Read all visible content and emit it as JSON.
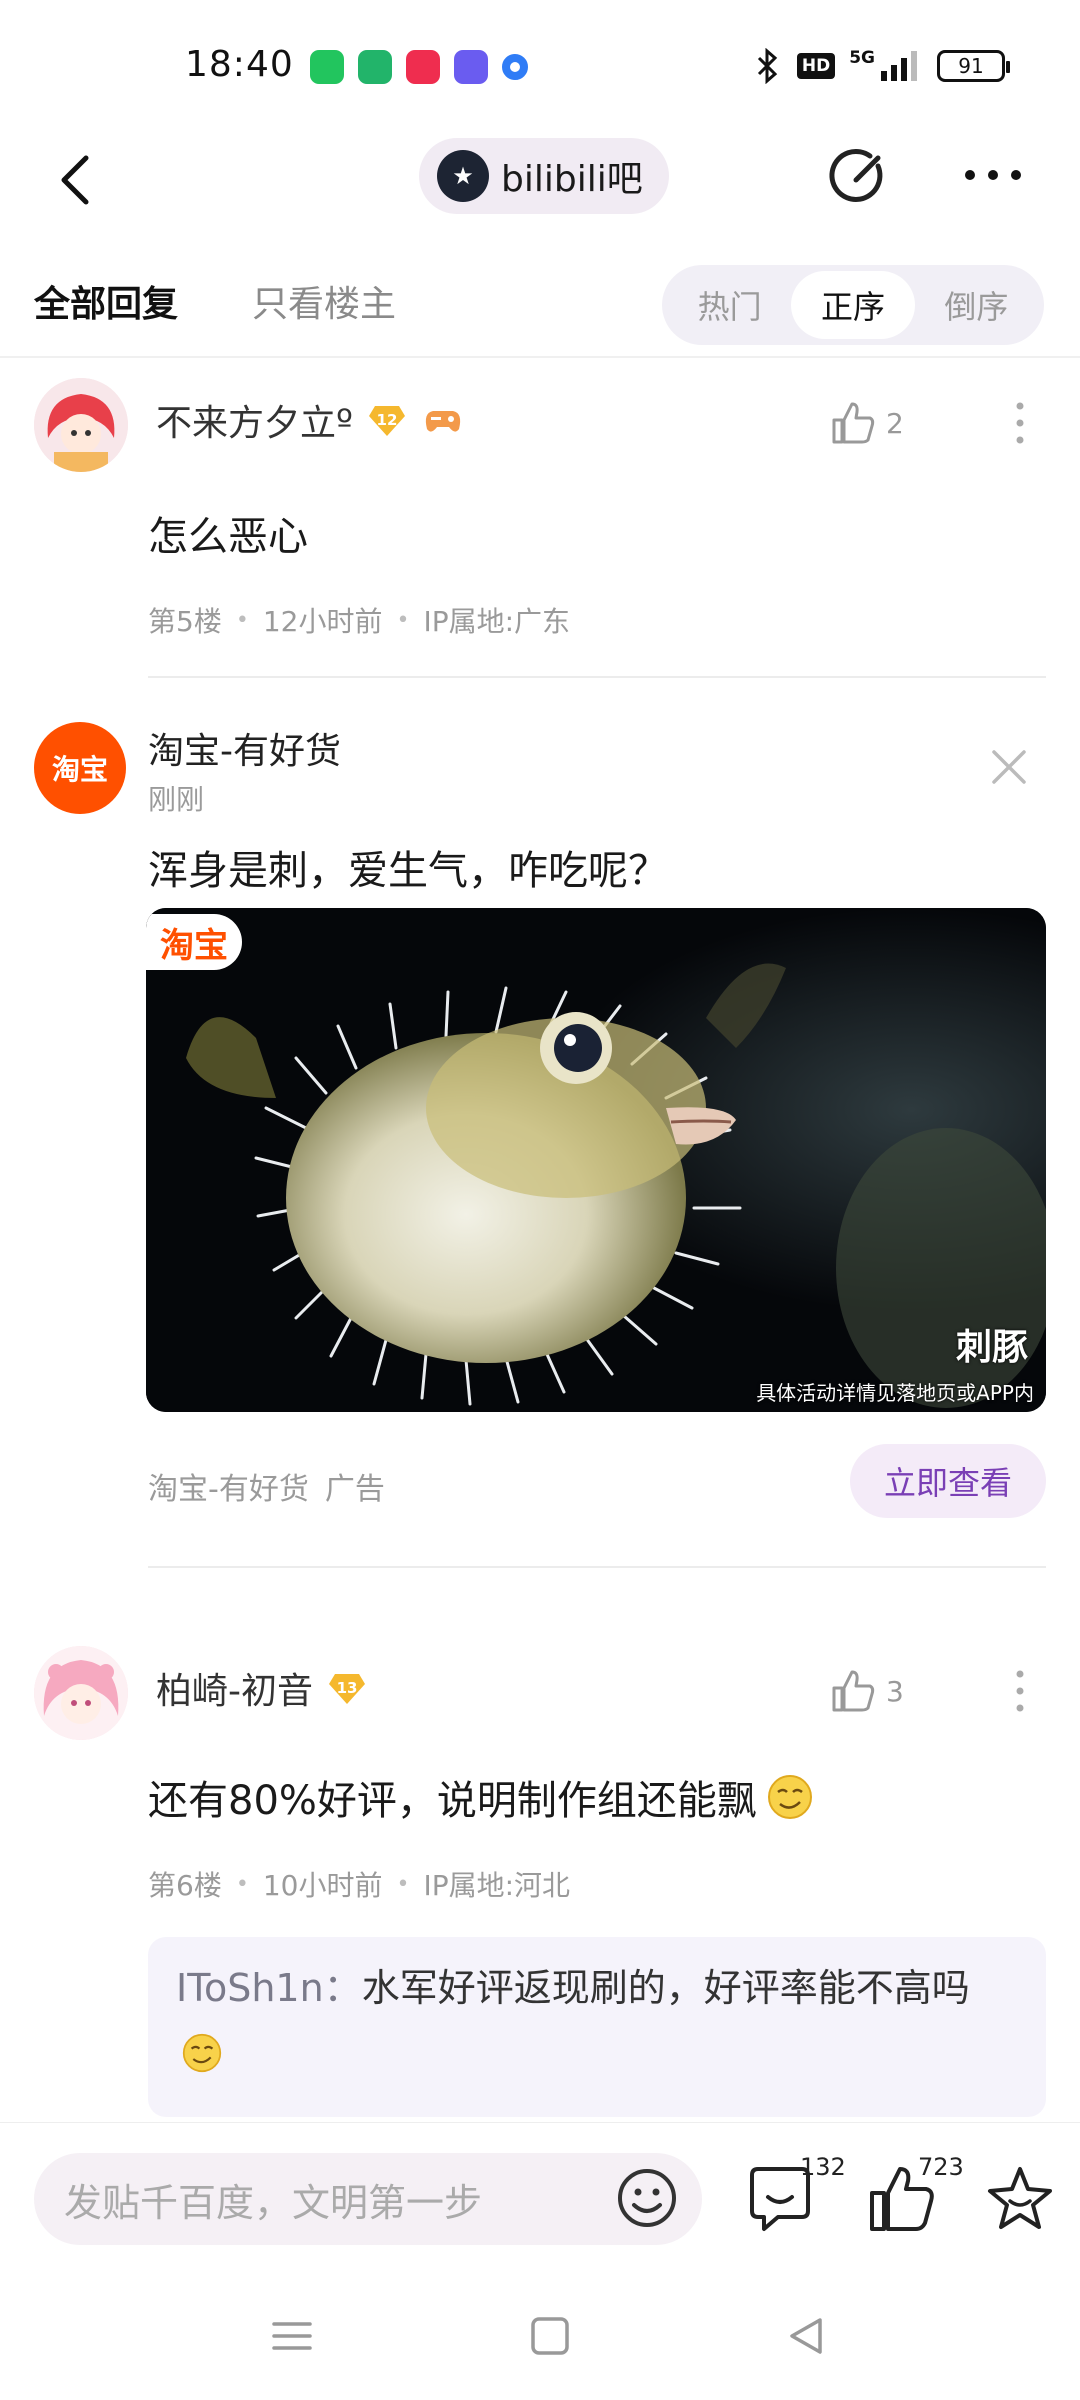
{
  "status_bar": {
    "time": "18:40",
    "network": "5G",
    "battery": "91",
    "hd": "HD"
  },
  "top_nav": {
    "forum_name": "bilibili吧"
  },
  "filters": {
    "all_replies": "全部回复",
    "op_only": "只看楼主",
    "sort": [
      "热门",
      "正序",
      "倒序"
    ],
    "active_sort": "正序"
  },
  "posts": [
    {
      "username": "不来方夕立º",
      "level": "12",
      "likes": "2",
      "text": "怎么恶心",
      "floor": "第5楼",
      "time": "12小时前",
      "ip": "IP属地:广东"
    },
    {
      "username": "柏崎-初音",
      "level": "13",
      "likes": "3",
      "text": "还有80%好评，说明制作组还能飘",
      "floor": "第6楼",
      "time": "10小时前",
      "ip": "IP属地:河北",
      "quote_user": "IToSh1n：",
      "quote_text": "水军好评返现刷的，好评率能不高吗"
    }
  ],
  "ad": {
    "logo_text": "淘宝",
    "name": "淘宝-有好货",
    "time": "刚刚",
    "text": "浑身是刺，爱生气，咋吃呢？",
    "image_brand": "淘宝",
    "image_label": "刺豚",
    "image_disclaimer": "具体活动详情见落地页或APP内",
    "footer_name": "淘宝-有好货",
    "footer_tag": "广告",
    "cta": "立即查看"
  },
  "bottom_bar": {
    "input_placeholder": "发贴千百度，文明第一步",
    "comment_count": "132",
    "like_count": "723"
  },
  "colors": {
    "accent_purple": "#7a3fb5",
    "taobao_orange": "#ff5000",
    "badge_gold": "#f5b82e"
  }
}
